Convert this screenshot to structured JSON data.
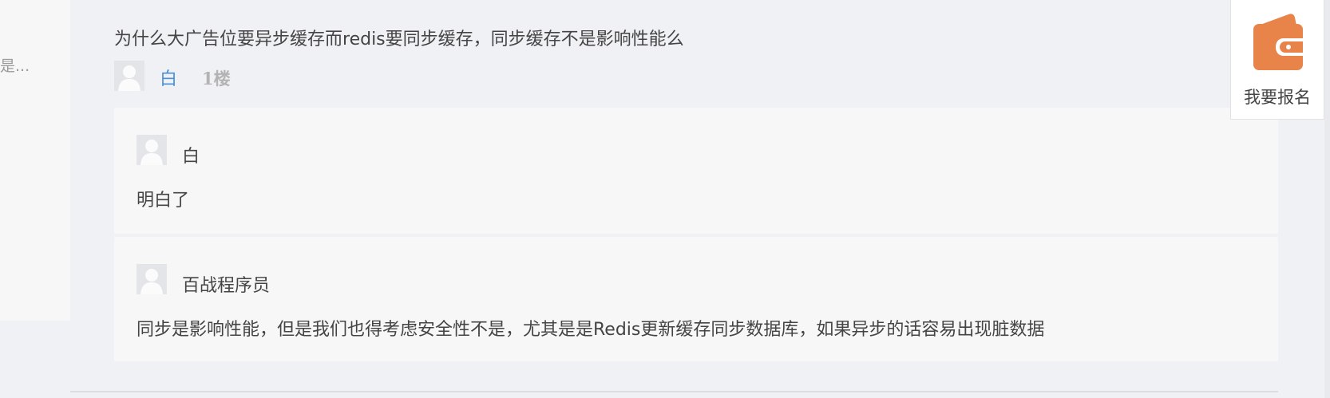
{
  "sidebar": {
    "truncated_text": "是..."
  },
  "question": {
    "text": "为什么大广告位要异步缓存而redis要同步缓存，同步缓存不是影响性能么",
    "author": "白",
    "floor": "1楼"
  },
  "replies": [
    {
      "user": "白",
      "text": "明白了"
    },
    {
      "user": "百战程序员",
      "text": "同步是影响性能，但是我们也得考虑安全性不是，尤其是是Redis更新缓存同步数据库，如果异步的话容易出现脏数据"
    }
  ],
  "signup": {
    "label": "我要报名",
    "icon": "wallet-icon",
    "color": "#e8834a"
  },
  "colors": {
    "link": "#4a90d9",
    "floor": "#b3b3b3",
    "background": "#f0f1f4",
    "card": "#f7f7f8"
  }
}
